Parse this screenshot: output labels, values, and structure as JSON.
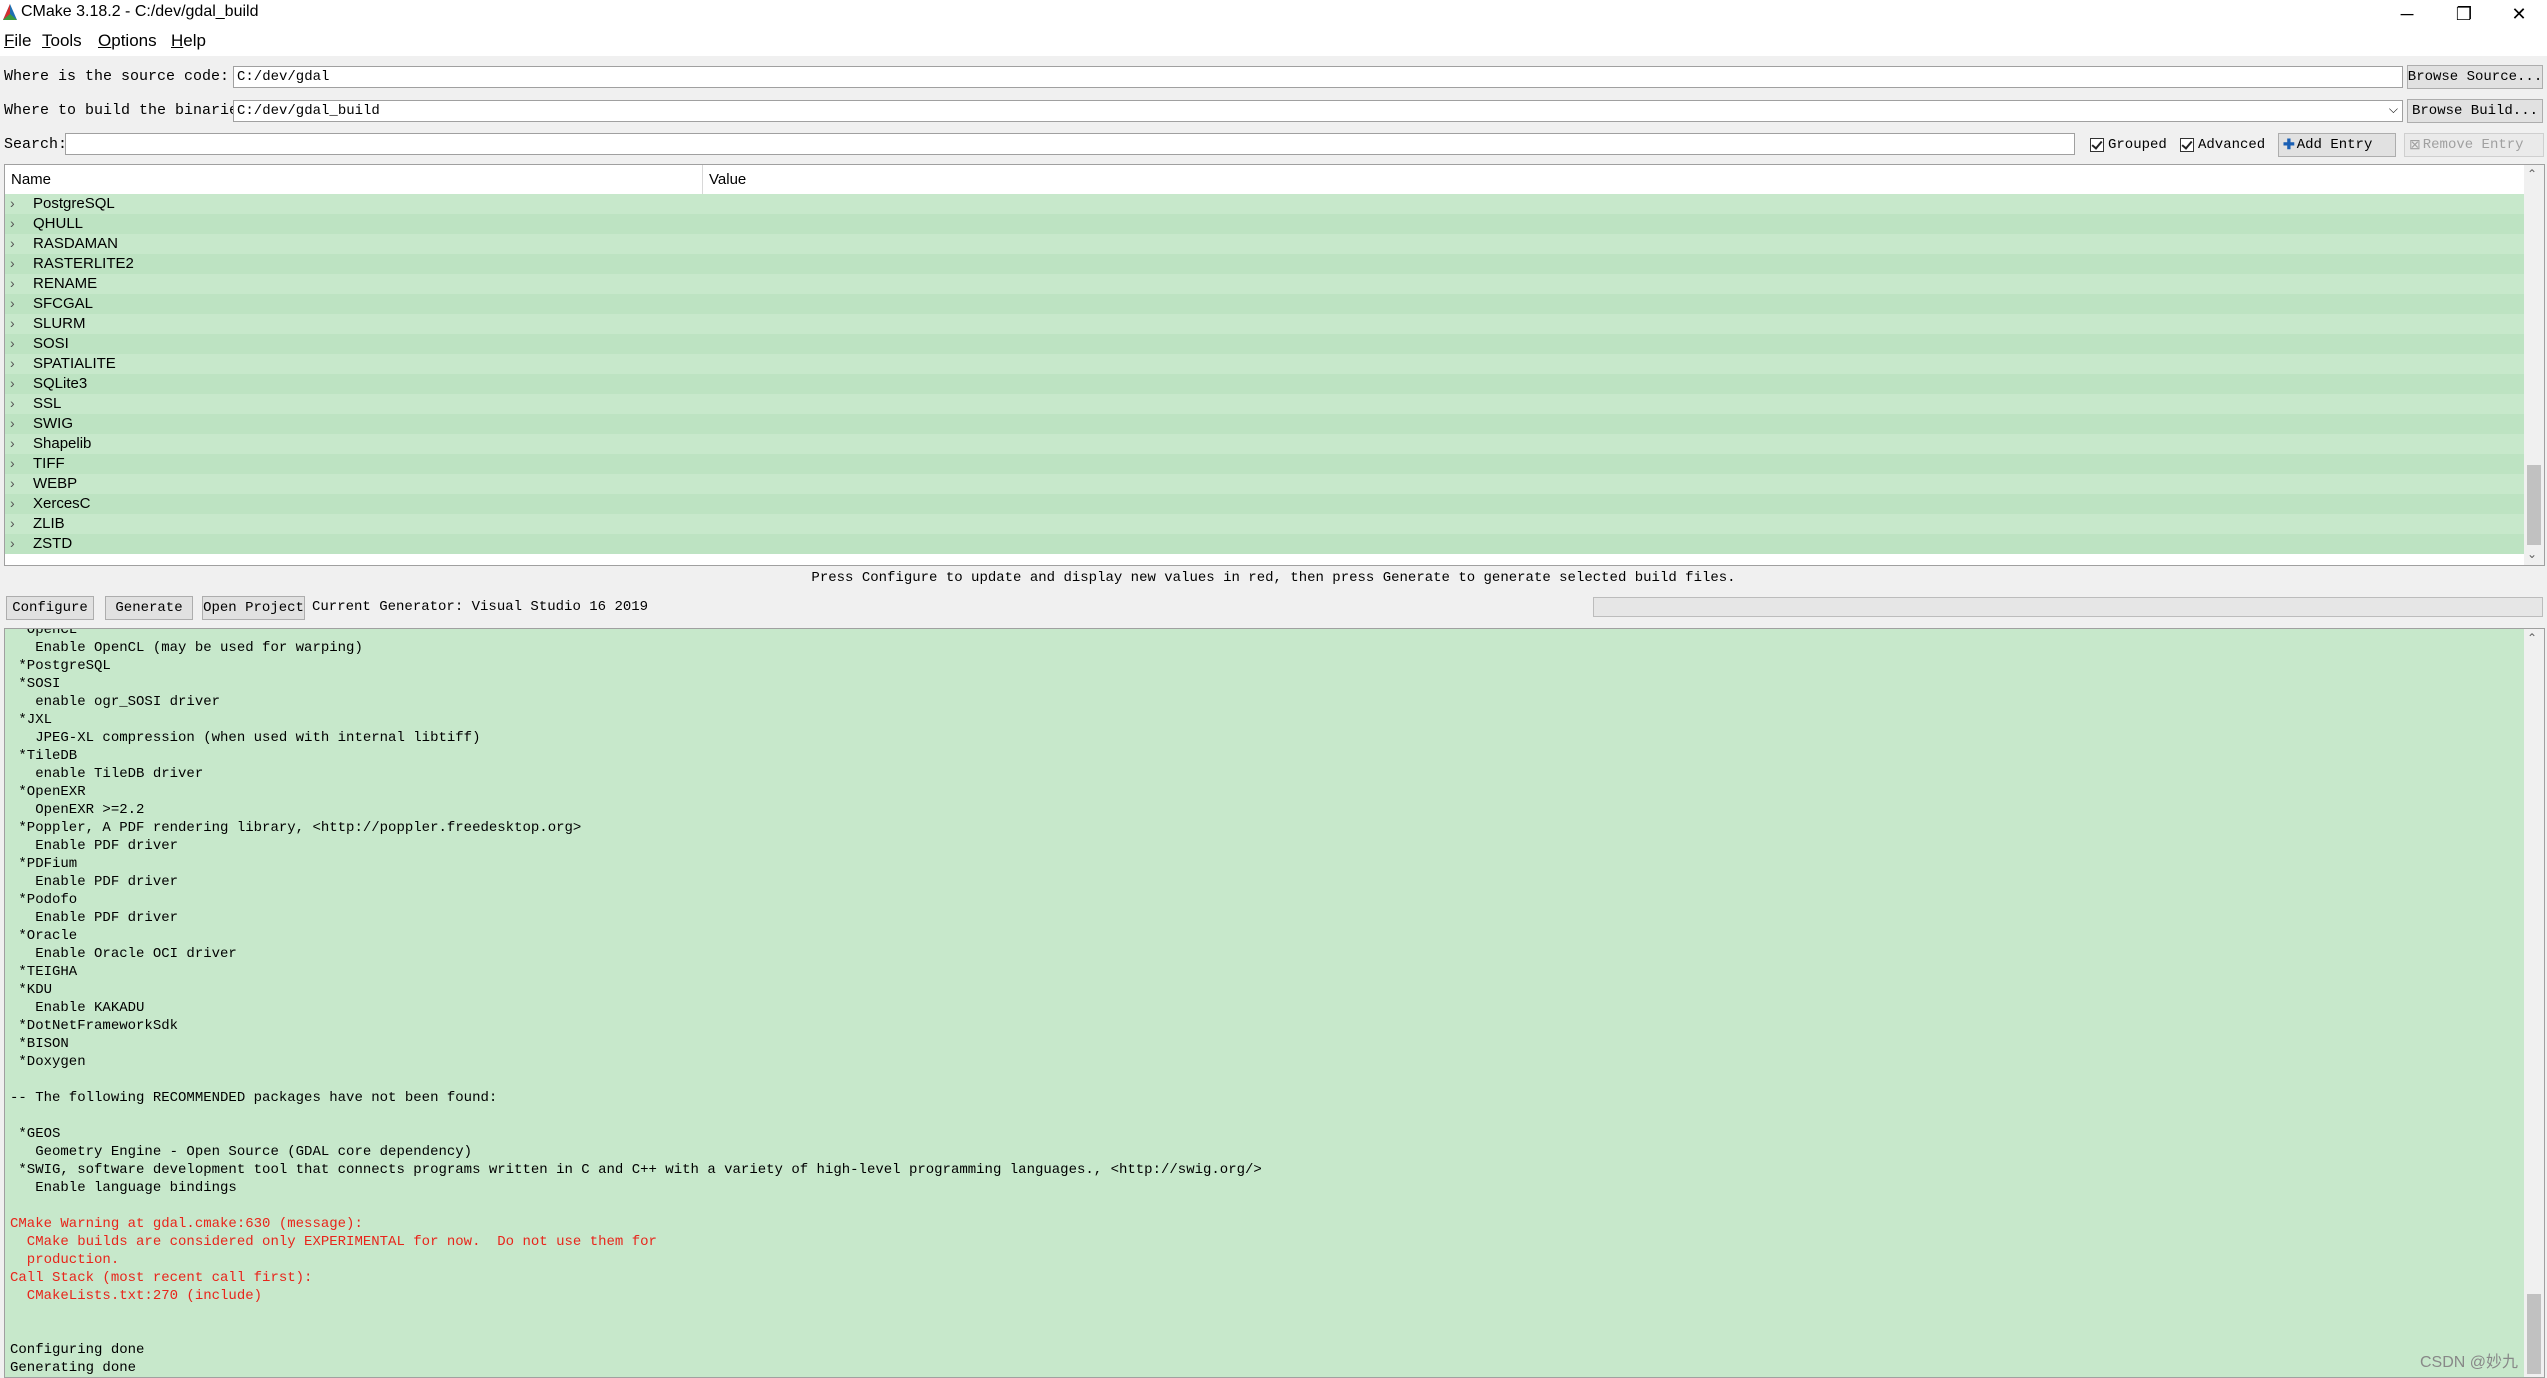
{
  "window": {
    "title": "CMake 3.18.2 - C:/dev/gdal_build",
    "minimize": "─",
    "maximize": "❐",
    "close": "✕"
  },
  "menu": [
    {
      "acc": "F",
      "rest": "ile"
    },
    {
      "acc": "T",
      "rest": "ools"
    },
    {
      "acc": "O",
      "rest": "ptions"
    },
    {
      "acc": "H",
      "rest": "elp"
    }
  ],
  "source": {
    "label": "Where is the source code:",
    "value": "C:/dev/gdal",
    "browse": "Browse Source..."
  },
  "binaries": {
    "label": "Where to build the binaries:",
    "value": "C:/dev/gdal_build",
    "browse": "Browse Build..."
  },
  "search": {
    "label": "Search:",
    "value": ""
  },
  "options": {
    "grouped": "Grouped",
    "advanced": "Advanced",
    "add_entry": "Add Entry",
    "remove_entry": "Remove Entry"
  },
  "tree": {
    "col_name": "Name",
    "col_value": "Value",
    "rows": [
      "PostgreSQL",
      "QHULL",
      "RASDAMAN",
      "RASTERLITE2",
      "RENAME",
      "SFCGAL",
      "SLURM",
      "SOSI",
      "SPATIALITE",
      "SQLite3",
      "SSL",
      "SWIG",
      "Shapelib",
      "TIFF",
      "WEBP",
      "XercesC",
      "ZLIB",
      "ZSTD"
    ]
  },
  "hint": "Press Configure to update and display new values in red, then press Generate to generate selected build files.",
  "actions": {
    "configure": "Configure",
    "generate": "Generate",
    "open_project": "Open Project",
    "generator": "Current Generator: Visual Studio 16 2019"
  },
  "output": [
    {
      "t": " *OpenCL",
      "c": "n"
    },
    {
      "t": "   Enable OpenCL (may be used for warping)",
      "c": "n"
    },
    {
      "t": " *PostgreSQL",
      "c": "n"
    },
    {
      "t": " *SOSI",
      "c": "n"
    },
    {
      "t": "   enable ogr_SOSI driver",
      "c": "n"
    },
    {
      "t": " *JXL",
      "c": "n"
    },
    {
      "t": "   JPEG-XL compression (when used with internal libtiff)",
      "c": "n"
    },
    {
      "t": " *TileDB",
      "c": "n"
    },
    {
      "t": "   enable TileDB driver",
      "c": "n"
    },
    {
      "t": " *OpenEXR",
      "c": "n"
    },
    {
      "t": "   OpenEXR >=2.2",
      "c": "n"
    },
    {
      "t": " *Poppler, A PDF rendering library, <http://poppler.freedesktop.org>",
      "c": "n"
    },
    {
      "t": "   Enable PDF driver",
      "c": "n"
    },
    {
      "t": " *PDFium",
      "c": "n"
    },
    {
      "t": "   Enable PDF driver",
      "c": "n"
    },
    {
      "t": " *Podofo",
      "c": "n"
    },
    {
      "t": "   Enable PDF driver",
      "c": "n"
    },
    {
      "t": " *Oracle",
      "c": "n"
    },
    {
      "t": "   Enable Oracle OCI driver",
      "c": "n"
    },
    {
      "t": " *TEIGHA",
      "c": "n"
    },
    {
      "t": " *KDU",
      "c": "n"
    },
    {
      "t": "   Enable KAKADU",
      "c": "n"
    },
    {
      "t": " *DotNetFrameworkSdk",
      "c": "n"
    },
    {
      "t": " *BISON",
      "c": "n"
    },
    {
      "t": " *Doxygen",
      "c": "n"
    },
    {
      "t": "",
      "c": "n"
    },
    {
      "t": "-- The following RECOMMENDED packages have not been found:",
      "c": "n"
    },
    {
      "t": "",
      "c": "n"
    },
    {
      "t": " *GEOS",
      "c": "n"
    },
    {
      "t": "   Geometry Engine - Open Source (GDAL core dependency)",
      "c": "n"
    },
    {
      "t": " *SWIG, software development tool that connects programs written in C and C++ with a variety of high-level programming languages., <http://swig.org/>",
      "c": "n"
    },
    {
      "t": "   Enable language bindings",
      "c": "n"
    },
    {
      "t": "",
      "c": "n"
    },
    {
      "t": "CMake Warning at gdal.cmake:630 (message):",
      "c": "r"
    },
    {
      "t": "  CMake builds are considered only EXPERIMENTAL for now.  Do not use them for",
      "c": "r"
    },
    {
      "t": "  production.",
      "c": "r"
    },
    {
      "t": "Call Stack (most recent call first):",
      "c": "r"
    },
    {
      "t": "  CMakeLists.txt:270 (include)",
      "c": "r"
    },
    {
      "t": "",
      "c": "n"
    },
    {
      "t": "",
      "c": "n"
    },
    {
      "t": "Configuring done",
      "c": "n"
    },
    {
      "t": "Generating done",
      "c": "n"
    }
  ],
  "watermark": "CSDN @妙九"
}
